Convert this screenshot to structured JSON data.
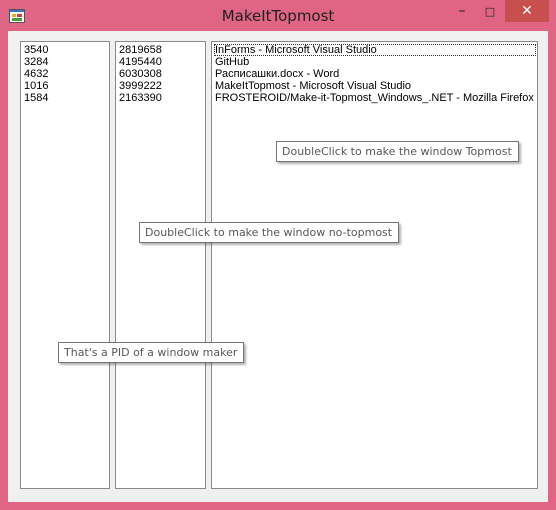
{
  "window": {
    "title": "MakeItTopmost"
  },
  "controls": {
    "minimize": "–",
    "maximize": "□",
    "close": "✕"
  },
  "pid_list": [
    "3540",
    "3284",
    "4632",
    "1016",
    "1584"
  ],
  "hwnd_list": [
    "2819658",
    "4195440",
    "6030308",
    "3999222",
    "2163390"
  ],
  "title_list": [
    "InForms - Microsoft Visual Studio",
    "GitHub",
    "Расписашки.docx - Word",
    "MakeItTopmost - Microsoft Visual Studio",
    "FROSTEROID/Make-it-Topmost_Windows_.NET - Mozilla Firefox"
  ],
  "tooltips": {
    "topmost": "DoubleClick to make the window Topmost",
    "no_topmost": "DoubleClick to make the window no-topmost",
    "pid": "That's a PID of a window maker"
  },
  "colors": {
    "frame": "#e06584",
    "close_button": "#c7504f",
    "client": "#f0f0f0"
  }
}
